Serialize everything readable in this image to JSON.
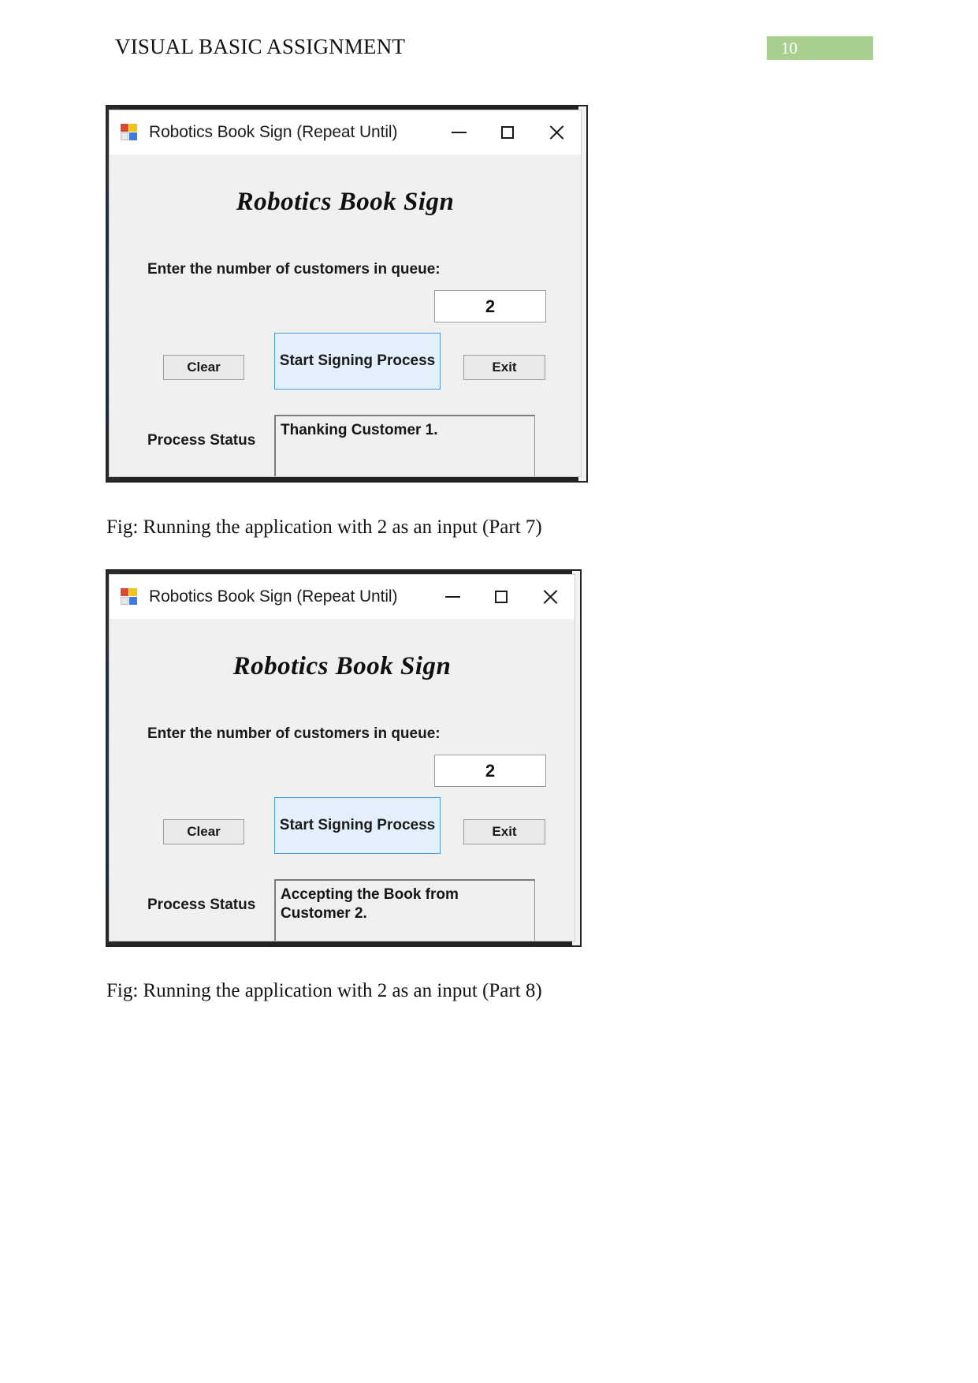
{
  "document": {
    "header_title": "VISUAL BASIC ASSIGNMENT",
    "page_number": "10"
  },
  "colors": {
    "page_badge_bg": "#a8cf8e",
    "primary_button_bg": "#e3f0fb",
    "primary_button_border": "#4a9ae0",
    "form_bg": "#f0f0f0",
    "titlebar_bg": "#ffffff"
  },
  "figures": [
    {
      "window": {
        "title": "Robotics Book Sign (Repeat Until)",
        "icon": "vb-form-icon",
        "caption_buttons": {
          "minimize": "minimize-icon",
          "maximize": "maximize-icon",
          "close": "close-icon"
        },
        "heading": "Robotics Book Sign",
        "input_label": "Enter the number of customers in queue:",
        "input_value": "2",
        "input_placeholder": "",
        "buttons": {
          "clear": "Clear",
          "start": "Start Signing Process",
          "exit": "Exit"
        },
        "status_label": "Process Status",
        "status_value": "Thanking Customer 1."
      },
      "caption": "Fig: Running the application with 2 as an input (Part 7)"
    },
    {
      "window": {
        "title": "Robotics Book Sign (Repeat Until)",
        "icon": "vb-form-icon",
        "caption_buttons": {
          "minimize": "minimize-icon",
          "maximize": "maximize-icon",
          "close": "close-icon"
        },
        "heading": "Robotics Book Sign",
        "input_label": "Enter the number of customers in queue:",
        "input_value": "2",
        "input_placeholder": "",
        "buttons": {
          "clear": "Clear",
          "start": "Start Signing Process",
          "exit": "Exit"
        },
        "status_label": "Process Status",
        "status_value": "Accepting the Book from Customer 2."
      },
      "caption": "Fig: Running the application with 2 as an input (Part 8)"
    }
  ]
}
